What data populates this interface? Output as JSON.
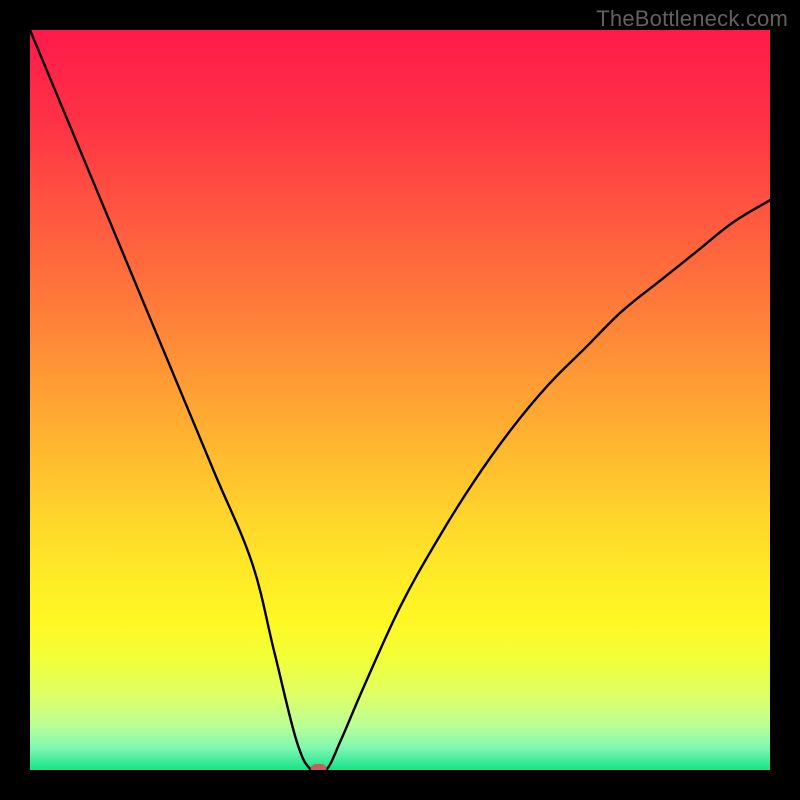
{
  "watermark": "TheBottleneck.com",
  "chart_data": {
    "type": "line",
    "title": "",
    "xlabel": "",
    "ylabel": "",
    "xlim": [
      0,
      100
    ],
    "ylim": [
      0,
      100
    ],
    "grid": false,
    "series": [
      {
        "name": "curve",
        "x": [
          0,
          5,
          10,
          15,
          20,
          25,
          30,
          33,
          36,
          38,
          40,
          42,
          45,
          50,
          55,
          60,
          65,
          70,
          75,
          80,
          85,
          90,
          95,
          100
        ],
        "y": [
          100,
          88,
          76,
          64,
          52,
          40,
          28,
          16,
          4,
          0,
          0,
          4,
          11,
          22,
          31,
          39,
          46,
          52,
          57,
          62,
          66,
          70,
          74,
          77
        ]
      }
    ],
    "annotations": [
      {
        "type": "marker",
        "x": 39,
        "y": 0,
        "color": "#c5605f",
        "shape": "rounded-rect"
      }
    ],
    "gradient_stops": [
      {
        "pos": 0.0,
        "color": "#ff1a4b"
      },
      {
        "pos": 0.12,
        "color": "#ff3146"
      },
      {
        "pos": 0.25,
        "color": "#ff5740"
      },
      {
        "pos": 0.38,
        "color": "#ff7d3a"
      },
      {
        "pos": 0.5,
        "color": "#ffa333"
      },
      {
        "pos": 0.62,
        "color": "#ffc92d"
      },
      {
        "pos": 0.72,
        "color": "#ffe628"
      },
      {
        "pos": 0.8,
        "color": "#fff824"
      },
      {
        "pos": 0.85,
        "color": "#f2ff38"
      },
      {
        "pos": 0.9,
        "color": "#deff66"
      },
      {
        "pos": 0.94,
        "color": "#baff96"
      },
      {
        "pos": 0.97,
        "color": "#80f8b0"
      },
      {
        "pos": 1.0,
        "color": "#14e38a"
      }
    ]
  }
}
